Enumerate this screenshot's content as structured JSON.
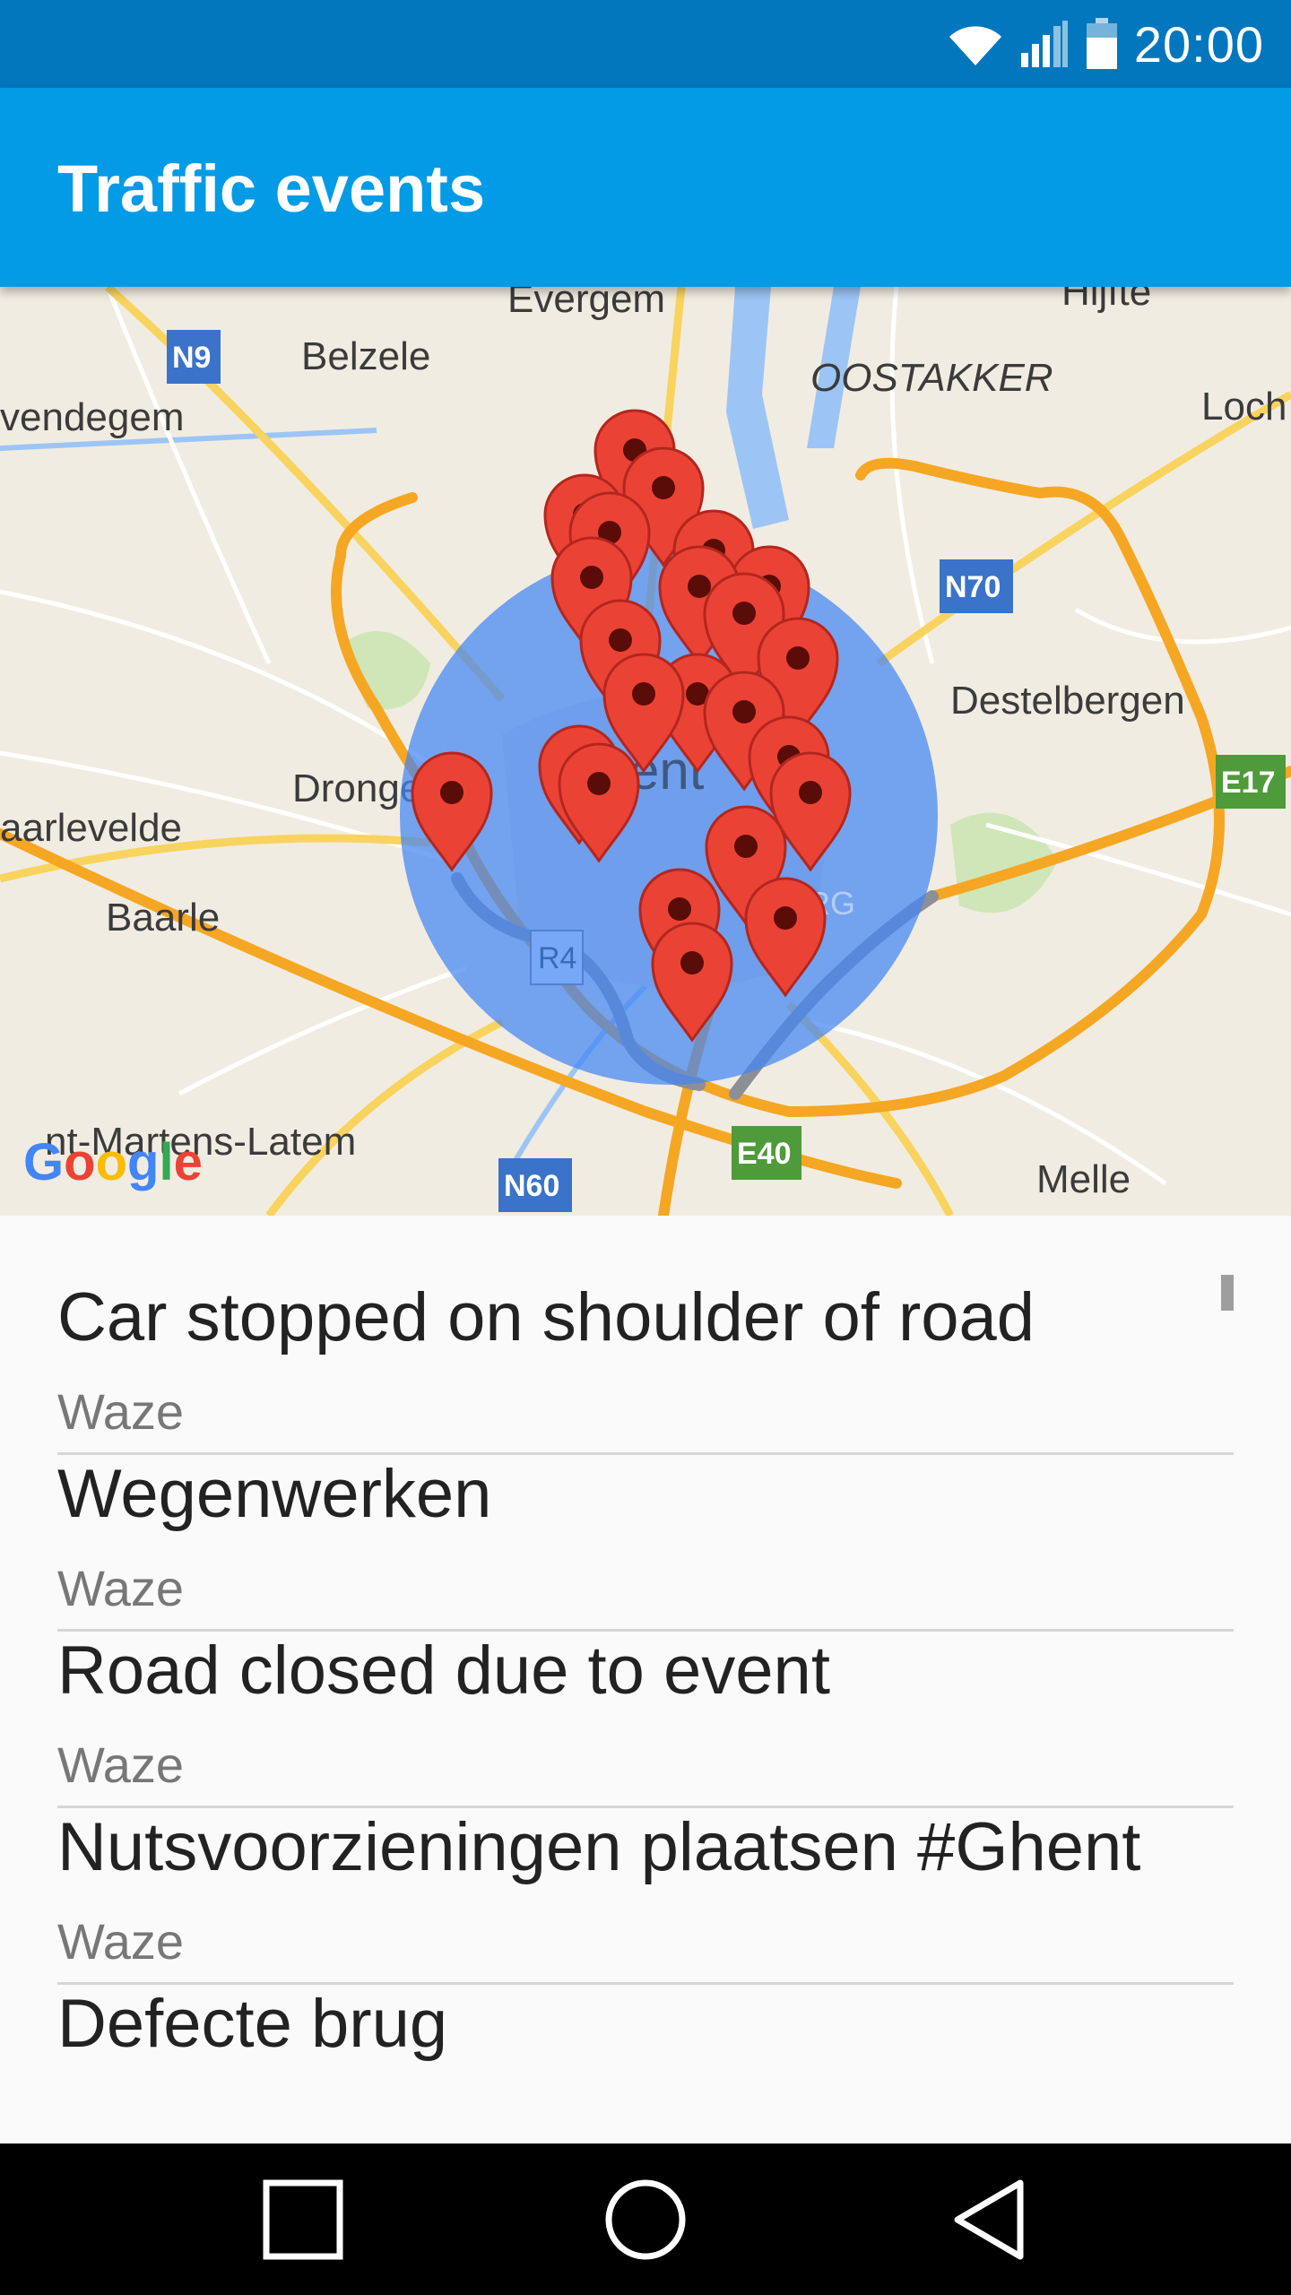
{
  "status_bar": {
    "time": "20:00",
    "icons": [
      "wifi-icon",
      "signal-icon",
      "battery-icon"
    ]
  },
  "app_bar": {
    "title": "Traffic events",
    "color": "#039be5"
  },
  "map": {
    "attribution": "Google",
    "place_labels": [
      "Evergem",
      "Belzele",
      "Hijfte",
      "OOSTAKKER",
      "Loch",
      "vendegem",
      "Destelbergen",
      "Dronge",
      "aarlevelde",
      "Baarle",
      "nt-Martens-Latem",
      "Melle",
      "ent",
      "RG"
    ],
    "road_shields": [
      "N9",
      "N70",
      "E17",
      "R4",
      "E40",
      "N60"
    ],
    "marker_color": "#ea4335",
    "radius_color": "#4285f4"
  },
  "events": [
    {
      "title": "Car stopped on shoulder of road",
      "source": "Waze"
    },
    {
      "title": "Wegenwerken",
      "source": "Waze"
    },
    {
      "title": "Road closed due to event",
      "source": "Waze"
    },
    {
      "title": "Nutsvoorzieningen plaatsen #Ghent",
      "source": "Waze"
    },
    {
      "title": "Defecte brug",
      "source": ""
    }
  ],
  "nav_bar": {
    "buttons": [
      "recents-icon",
      "home-icon",
      "back-icon"
    ]
  }
}
